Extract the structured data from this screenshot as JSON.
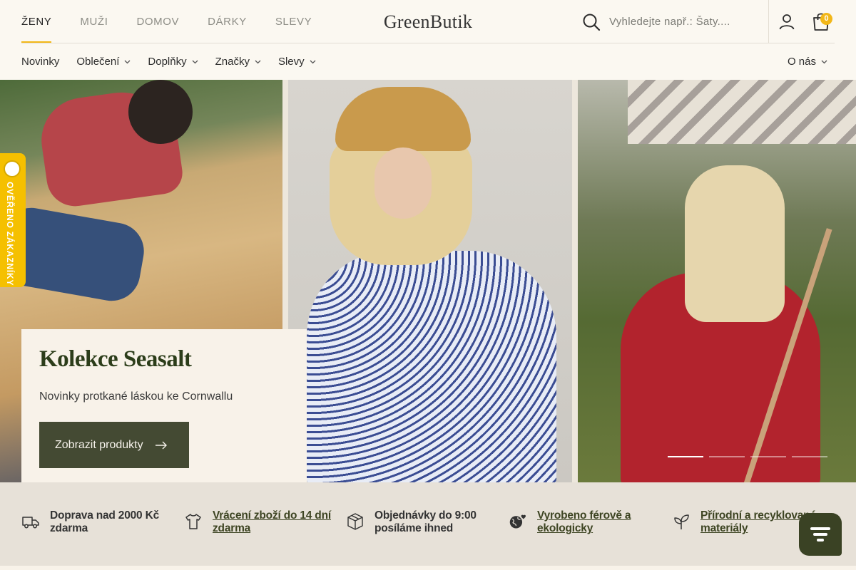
{
  "header": {
    "nav": [
      "ŽENY",
      "MUŽI",
      "DOMOV",
      "DÁRKY",
      "SLEVY"
    ],
    "logo": "GreenButik",
    "search_placeholder": "Vyhledejte např.: Šaty....",
    "cart_count": "0"
  },
  "subnav": {
    "items": [
      "Novinky",
      "Oblečení",
      "Doplňky",
      "Značky",
      "Slevy"
    ],
    "about": "O nás"
  },
  "hero": {
    "title": "Kolekce Seasalt",
    "subtitle": "Novinky protkané láskou ke Cornwallu",
    "button": "Zobrazit produkty",
    "slides": 4,
    "active_slide": 1
  },
  "badge": {
    "label": "OVĚŘENO ZÁKAZNÍKY"
  },
  "benefits": [
    {
      "icon": "truck-icon",
      "text": "Doprava nad 2000 Kč zdarma",
      "link": false
    },
    {
      "icon": "tshirt-icon",
      "text": "Vrácení zboží do 14 dní zdarma",
      "link": true
    },
    {
      "icon": "box-icon",
      "text": "Objednávky do 9:00 posíláme ihned",
      "link": false
    },
    {
      "icon": "globe-heart-icon",
      "text": "Vyrobeno férově a ekologicky",
      "link": true
    },
    {
      "icon": "leaf-icon",
      "text": "Přírodní a recyklované materiály",
      "link": true
    }
  ],
  "colors": {
    "accent": "#f2b718",
    "button": "#444a33",
    "brand_green": "#2c3d1a"
  }
}
